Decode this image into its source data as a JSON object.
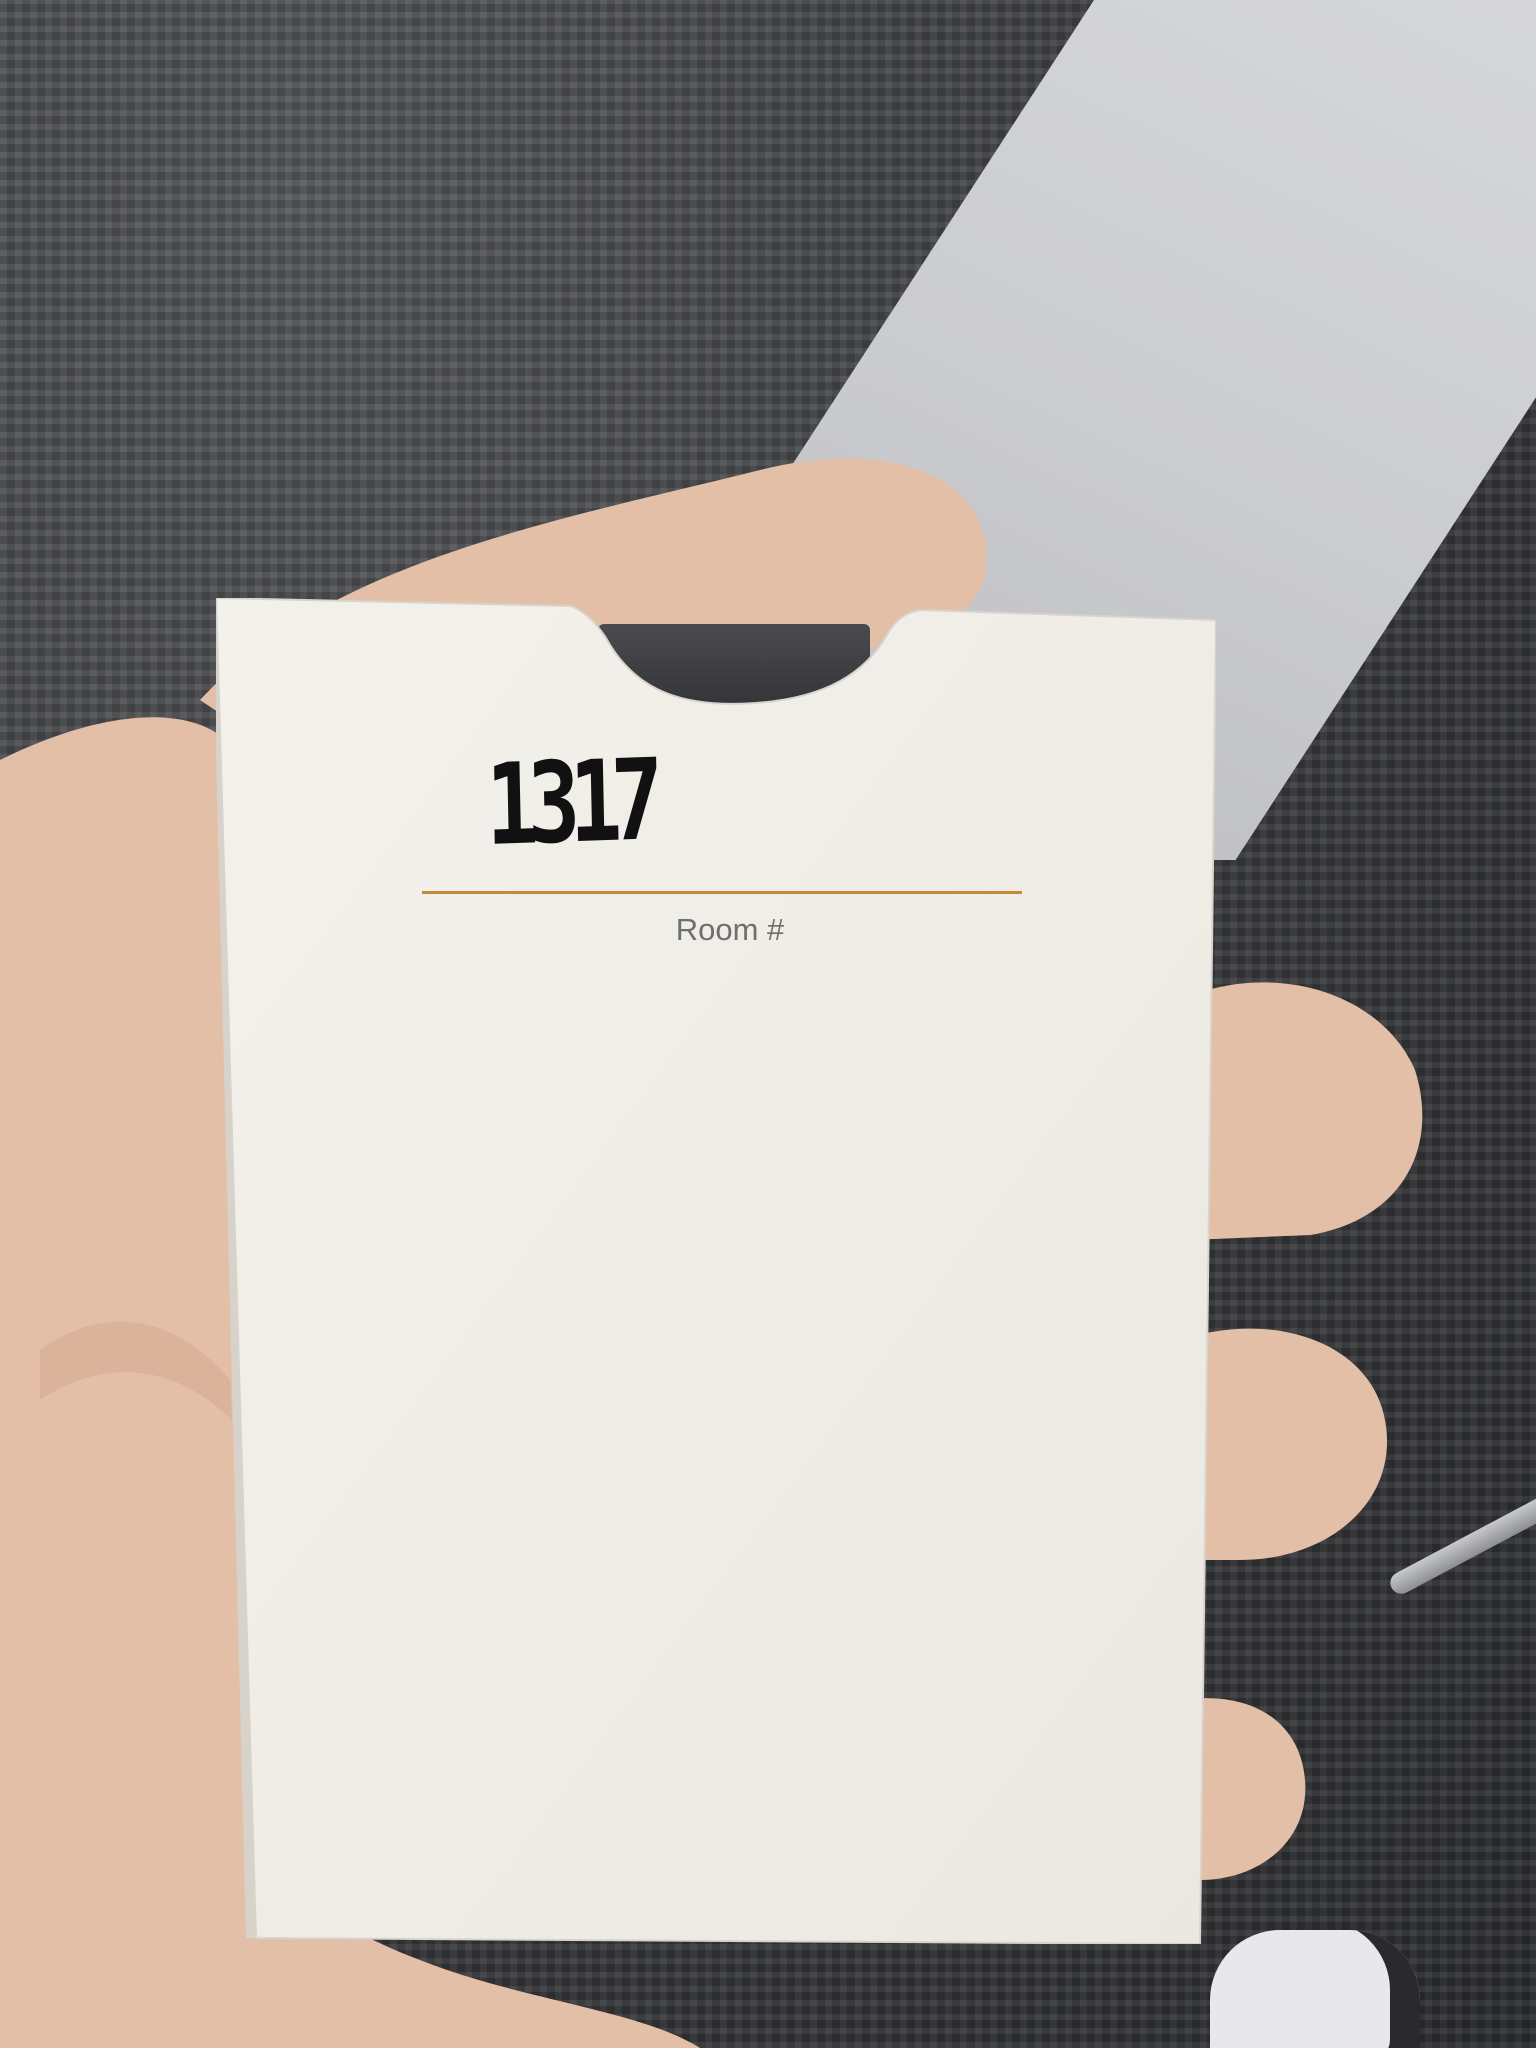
{
  "card": {
    "room_number": "1317",
    "room_label": "Room #"
  },
  "colors": {
    "carpet": "#3c3d40",
    "card_stock": "#f1efe9",
    "underline": "#c48a3b",
    "label_text": "#6f6f6f",
    "ink": "#111111",
    "skin": "#e3bfa8"
  }
}
